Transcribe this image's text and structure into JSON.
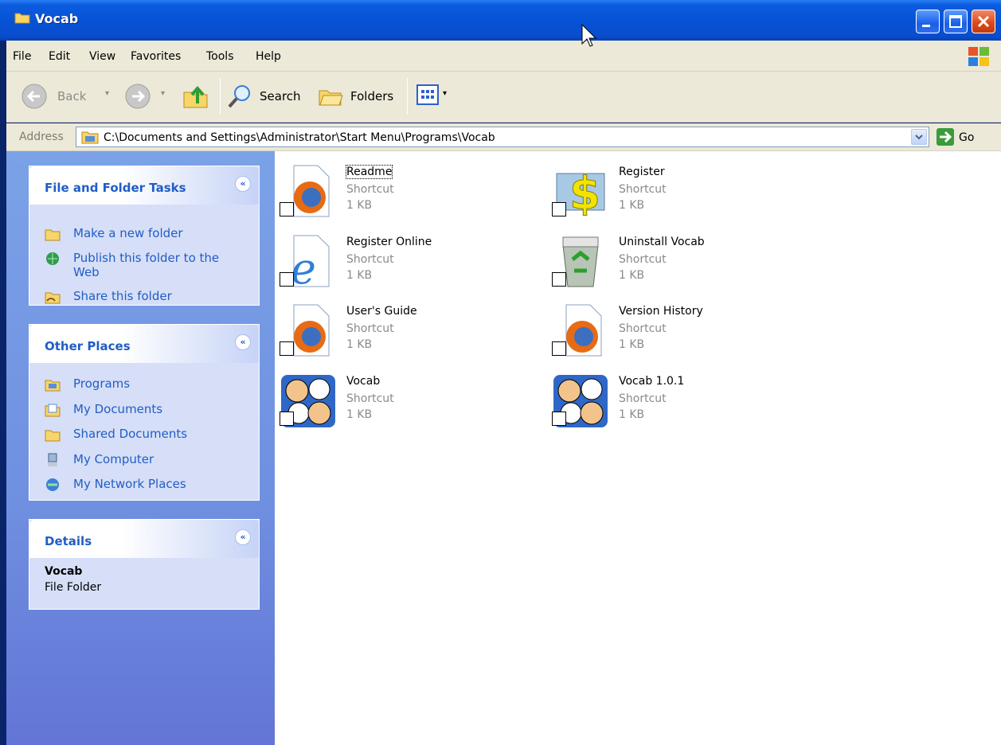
{
  "window": {
    "title": "Vocab"
  },
  "menu": {
    "items": [
      "File",
      "Edit",
      "View",
      "Favorites",
      "Tools",
      "Help"
    ]
  },
  "toolbar": {
    "back": "Back",
    "search": "Search",
    "folders": "Folders"
  },
  "address": {
    "label": "Address",
    "path": "C:\\Documents and Settings\\Administrator\\Start Menu\\Programs\\Vocab",
    "go": "Go"
  },
  "tasks_panel": {
    "title": "File and Folder Tasks",
    "items": [
      "Make a new folder",
      "Publish this folder to the",
      "Web",
      "Share this folder"
    ]
  },
  "places_panel": {
    "title": "Other Places",
    "items": [
      "Programs",
      "My Documents",
      "Shared Documents",
      "My Computer",
      "My Network Places"
    ]
  },
  "details_panel": {
    "title": "Details",
    "name": "Vocab",
    "kind": "File Folder"
  },
  "files": [
    {
      "name": "Readme",
      "type": "Shortcut",
      "size": "1 KB",
      "icon": "firefox-document-icon"
    },
    {
      "name": "Register",
      "type": "Shortcut",
      "size": "1 KB",
      "icon": "dollar-register-icon"
    },
    {
      "name": "Register Online",
      "type": "Shortcut",
      "size": "1 KB",
      "icon": "internet-explorer-icon"
    },
    {
      "name": "Uninstall Vocab",
      "type": "Shortcut",
      "size": "1 KB",
      "icon": "recycle-bin-icon"
    },
    {
      "name": "User's Guide",
      "type": "Shortcut",
      "size": "1 KB",
      "icon": "firefox-document-icon"
    },
    {
      "name": "Version History",
      "type": "Shortcut",
      "size": "1 KB",
      "icon": "firefox-document-icon"
    },
    {
      "name": "Vocab",
      "type": "Shortcut",
      "size": "1 KB",
      "icon": "vocab-faces-icon"
    },
    {
      "name": "Vocab 1.0.1",
      "type": "Shortcut",
      "size": "1 KB",
      "icon": "vocab-faces-icon"
    }
  ],
  "colors": {
    "titlebar": "#0653d6",
    "pane": "#7ba2e7",
    "link": "#215dc6",
    "panel_bg": "#d6dff7"
  }
}
